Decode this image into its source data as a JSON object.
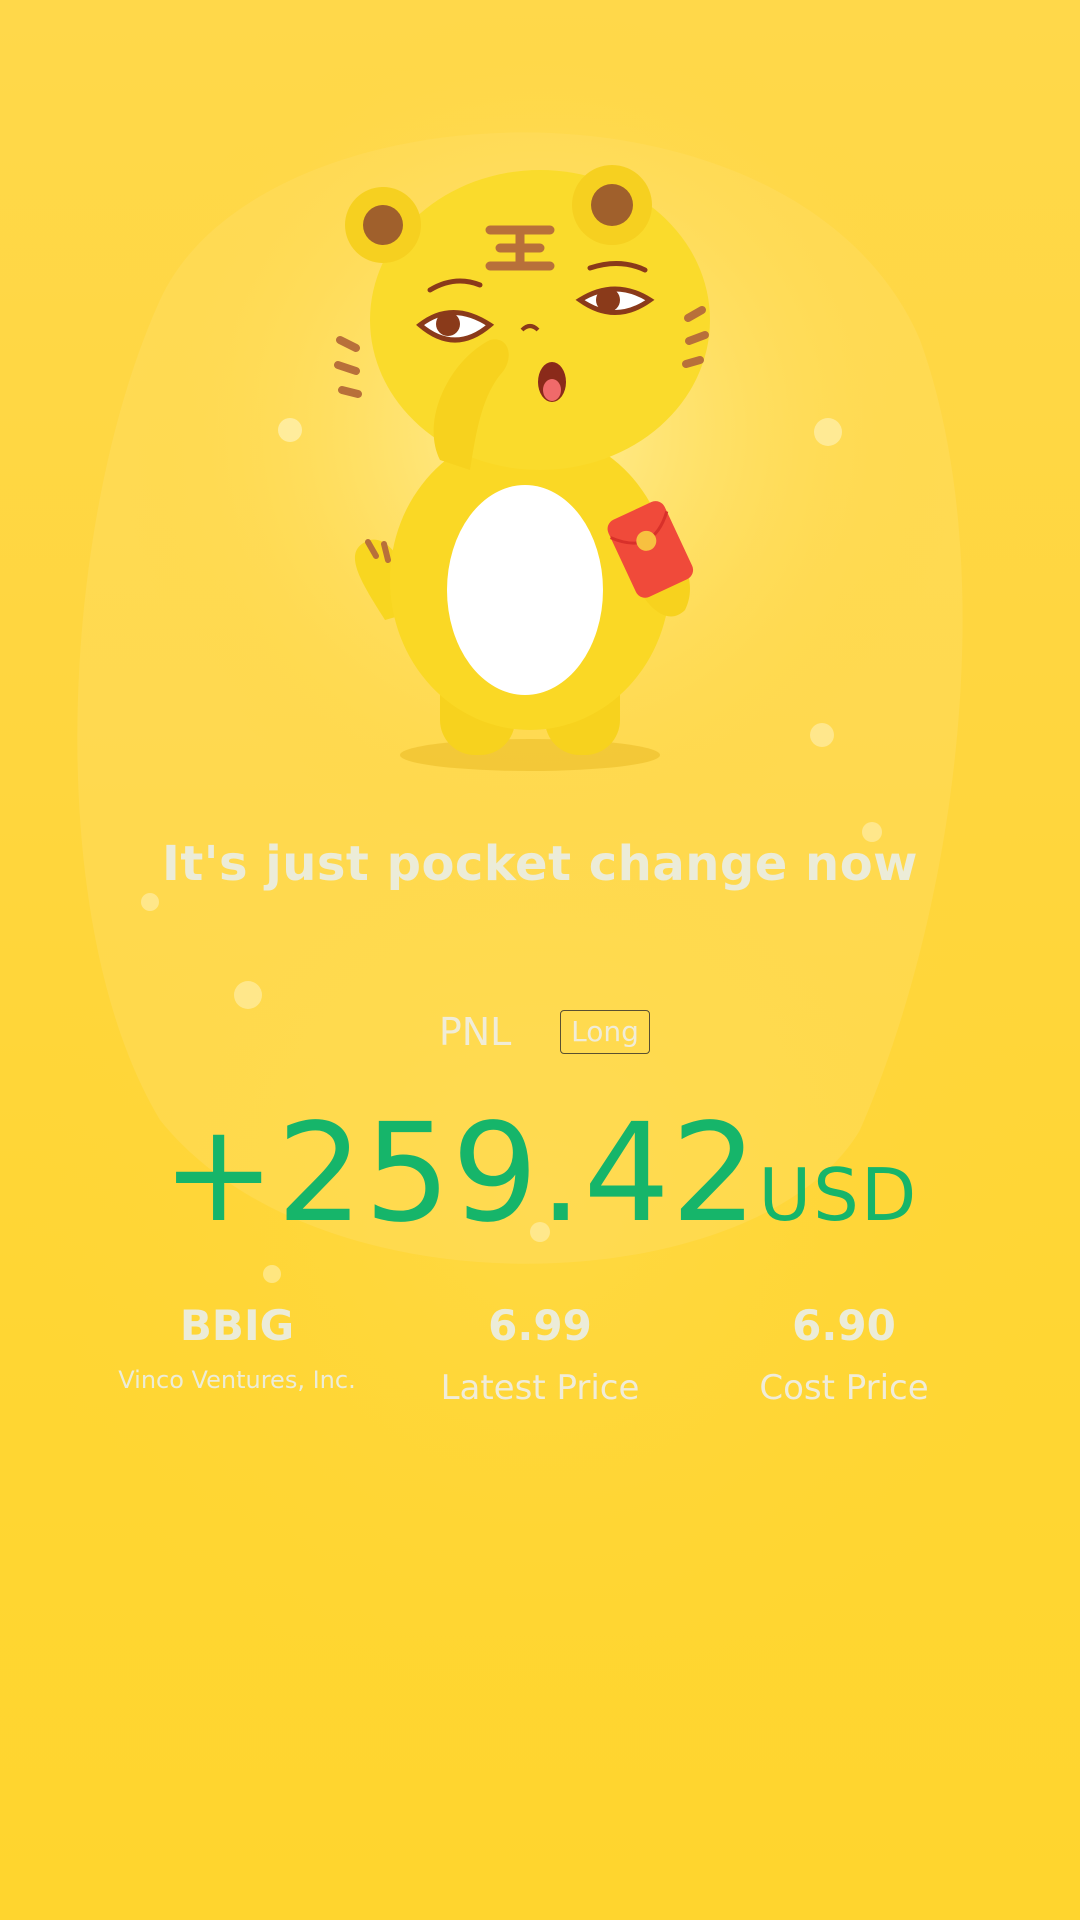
{
  "tagline": "It's just pocket change now",
  "pnl": {
    "label": "PNL",
    "direction": "Long",
    "amount": "+259.42",
    "currency": "USD"
  },
  "position": {
    "ticker": "BBIG",
    "company": "Vinco Ventures, Inc.",
    "latest_price": "6.99",
    "latest_price_label": "Latest Price",
    "cost_price": "6.90",
    "cost_price_label": "Cost Price"
  },
  "colors": {
    "background": "#ffd63e",
    "profit": "#16b56a",
    "muted_text": "#ececd8"
  },
  "mascot": {
    "icon": "tiger-mascot-icon",
    "holding": "red-envelope-icon"
  }
}
